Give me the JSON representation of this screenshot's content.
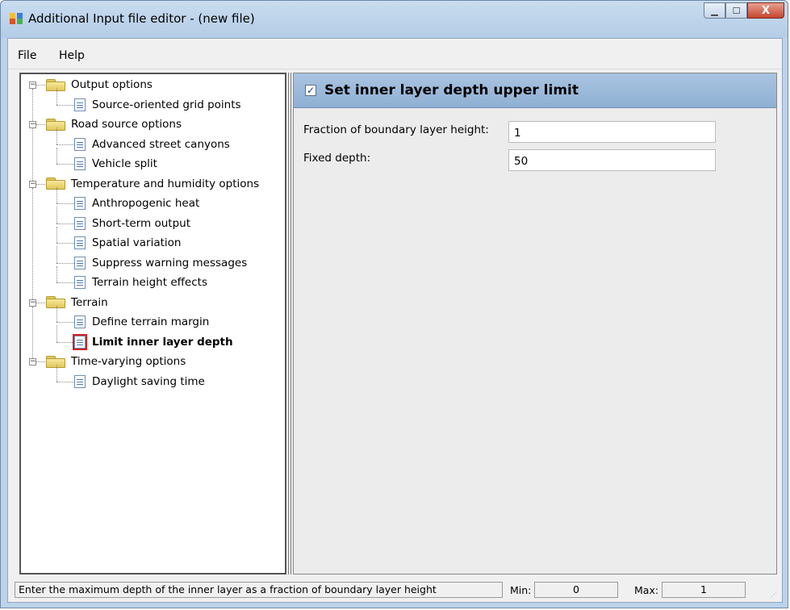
{
  "window": {
    "title": "Additional Input file editor - (new file)",
    "min": "—",
    "max": "☐",
    "close": "X"
  },
  "menu": [
    "File",
    "Help"
  ],
  "tree": [
    {
      "label": "Output options",
      "type": "folder",
      "level": 0
    },
    {
      "label": "Source-oriented grid points",
      "type": "doc",
      "level": 1
    },
    {
      "label": "Road source options",
      "type": "folder",
      "level": 0
    },
    {
      "label": "Advanced street canyons",
      "type": "doc",
      "level": 1
    },
    {
      "label": "Vehicle split",
      "type": "doc",
      "level": 1
    },
    {
      "label": "Temperature and humidity options",
      "type": "folder",
      "level": 0
    },
    {
      "label": "Anthropogenic heat",
      "type": "doc",
      "level": 1
    },
    {
      "label": "Short-term output",
      "type": "doc",
      "level": 1
    },
    {
      "label": "Spatial variation",
      "type": "doc",
      "level": 1
    },
    {
      "label": "Suppress warning messages",
      "type": "doc",
      "level": 1
    },
    {
      "label": "Terrain height effects",
      "type": "doc",
      "level": 1
    },
    {
      "label": "Terrain",
      "type": "folder",
      "level": 0
    },
    {
      "label": "Define terrain margin",
      "type": "doc",
      "level": 1
    },
    {
      "label": "Limit inner layer depth",
      "type": "doc",
      "level": 1,
      "selected": true
    },
    {
      "label": "Time-varying options",
      "type": "folder",
      "level": 0
    },
    {
      "label": "Daylight saving time",
      "type": "doc",
      "level": 1
    }
  ],
  "panel": {
    "header": "Set inner layer depth upper limit",
    "checked": true,
    "check_mark": "✓",
    "fields": [
      {
        "label": "Fraction of boundary layer height:",
        "value": "1"
      },
      {
        "label": "Fixed depth:",
        "value": "50"
      }
    ]
  },
  "status": {
    "message": "Enter the maximum depth of the inner layer as a fraction of boundary layer height",
    "min_label": "Min:",
    "min_value": "0",
    "max_label": "Max:",
    "max_value": "1"
  }
}
